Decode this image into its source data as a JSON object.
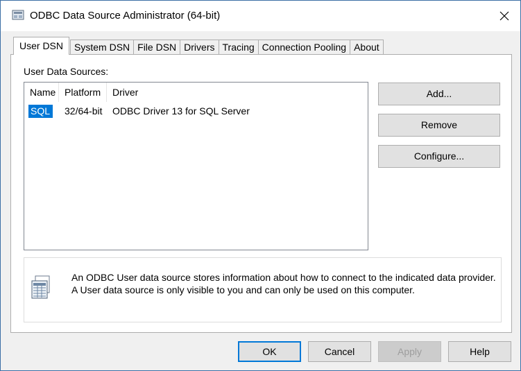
{
  "window": {
    "title": "ODBC Data Source Administrator (64-bit)"
  },
  "tabs": [
    {
      "label": "User DSN",
      "active": true
    },
    {
      "label": "System DSN"
    },
    {
      "label": "File DSN"
    },
    {
      "label": "Drivers"
    },
    {
      "label": "Tracing"
    },
    {
      "label": "Connection Pooling"
    },
    {
      "label": "About"
    }
  ],
  "panel": {
    "section_label": "User Data Sources:",
    "columns": [
      "Name",
      "Platform",
      "Driver"
    ],
    "rows": [
      {
        "name": "SQL",
        "platform": "32/64-bit",
        "driver": "ODBC Driver 13 for SQL Server"
      }
    ],
    "buttons": {
      "add": "Add...",
      "remove": "Remove",
      "configure": "Configure..."
    },
    "info_text": "An ODBC User data source stores information about how to connect to the indicated data provider.  A User data source is only visible to you and can only be used on this computer."
  },
  "footer": {
    "ok": "OK",
    "cancel": "Cancel",
    "apply": "Apply",
    "help": "Help"
  },
  "colors": {
    "accent": "#0078d7",
    "button_face": "#e1e1e1",
    "window_bg": "#f0f0f0"
  }
}
